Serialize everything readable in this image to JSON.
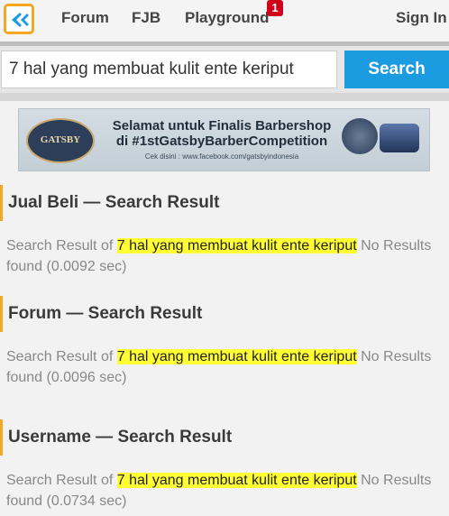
{
  "nav": {
    "links": [
      "Forum",
      "FJB",
      "Playground"
    ],
    "badge": "1",
    "signin": "Sign In"
  },
  "search": {
    "value": "7 hal yang membuat kulit ente keriput",
    "button": "Search"
  },
  "ad": {
    "logo_text": "GATSBY",
    "title_line1": "Selamat untuk Finalis Barbershop",
    "title_line2": "di #1stGatsbyBarberCompetition",
    "small": "Cek disini : www.facebook.com/gatsbyindonesia"
  },
  "sections": [
    {
      "title": "Jual Beli — Search Result",
      "prefix": "Search Result of ",
      "query": "7 hal yang membuat kulit ente keriput",
      "suffix": " No Results found (0.0092 sec)"
    },
    {
      "title": "Forum — Search Result",
      "prefix": "Search Result of ",
      "query": "7 hal yang membuat kulit ente keriput",
      "suffix": " No Results found (0.0096 sec)"
    },
    {
      "title": "Username — Search Result",
      "prefix": "Search Result of ",
      "query": "7 hal yang membuat kulit ente keriput",
      "suffix": "  No Results found (0.0734 sec)"
    }
  ],
  "colors": {
    "accent": "#f5a623",
    "search_button": "#1b9be0",
    "highlight": "#ffff33",
    "badge": "#d0021b"
  }
}
